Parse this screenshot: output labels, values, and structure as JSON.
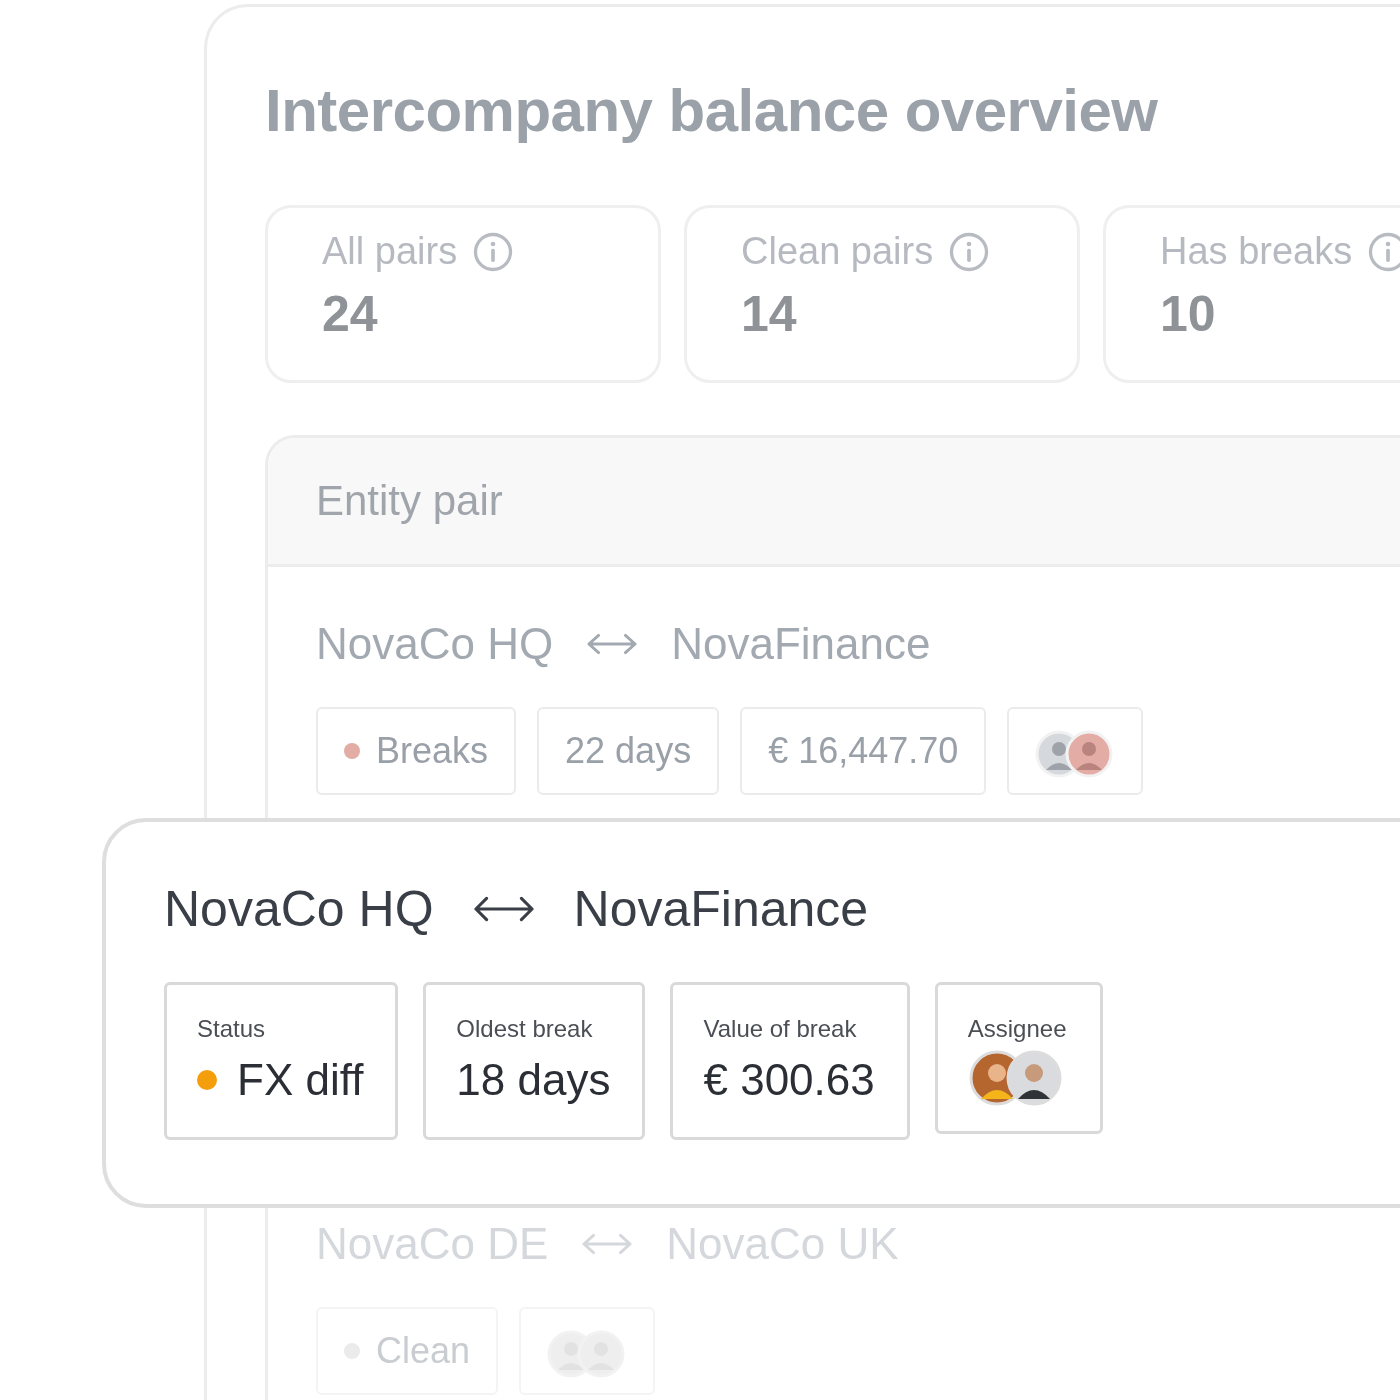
{
  "title": "Intercompany balance overview",
  "stats": [
    {
      "label": "All pairs",
      "value": "24"
    },
    {
      "label": "Clean pairs",
      "value": "14"
    },
    {
      "label": "Has breaks",
      "value": "10"
    }
  ],
  "table": {
    "header": "Entity pair",
    "rows": [
      {
        "from": "NovaCo HQ",
        "to": "NovaFinance",
        "chips": [
          {
            "kind": "status",
            "text": "Breaks",
            "color": "#e3aca5"
          },
          {
            "kind": "text",
            "text": "22 days"
          },
          {
            "kind": "text",
            "text": "€ 16,447.70"
          },
          {
            "kind": "avatars"
          }
        ]
      },
      {
        "from": "NovaCo DE",
        "to": "NovaCo UK",
        "chips": [
          {
            "kind": "status",
            "text": "Clean",
            "color": "#ebebeb"
          },
          {
            "kind": "avatars"
          }
        ]
      }
    ]
  },
  "detail": {
    "from": "NovaCo HQ",
    "to": "NovaFinance",
    "fields": [
      {
        "kind": "status",
        "label": "Status",
        "text": "FX diff",
        "color": "#f59e0b"
      },
      {
        "kind": "text",
        "label": "Oldest break",
        "text": "18 days"
      },
      {
        "kind": "text",
        "label": "Value of break",
        "text": "€ 300.63"
      },
      {
        "kind": "avatars",
        "label": "Assignee"
      }
    ]
  }
}
